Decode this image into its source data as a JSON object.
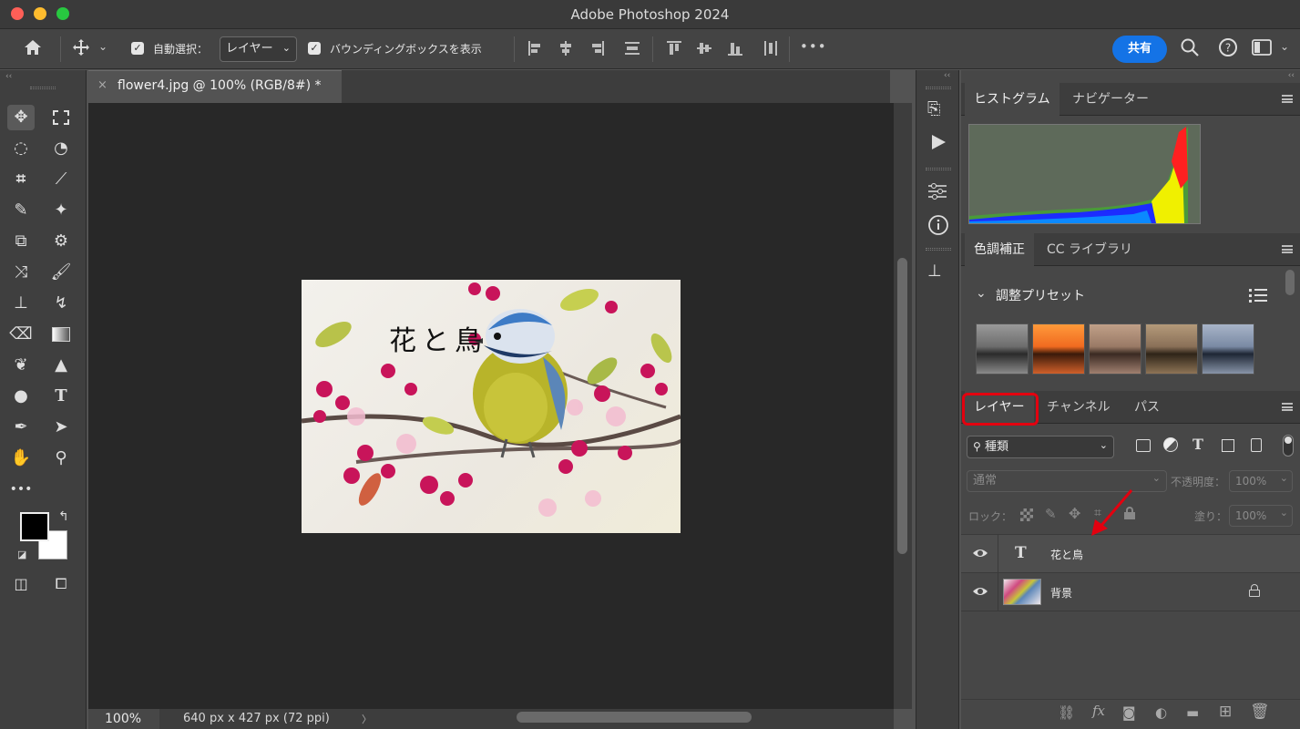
{
  "window": {
    "title": "Adobe Photoshop 2024"
  },
  "options_bar": {
    "auto_select_label": "自動選択：",
    "auto_select_value": "レイヤー",
    "bounding_box_label": "バウンディングボックスを表示",
    "share_label": "共有",
    "more_label": "•••"
  },
  "document": {
    "tab_label": "flower4.jpg @ 100% (RGB/8#) *",
    "close_glyph": "×",
    "canvas_text": "花と鳥",
    "zoom": "100%",
    "size_info": "640 px x 427 px (72 ppi)",
    "status_arrow": "〉"
  },
  "panels": {
    "histogram_tab": "ヒストグラム",
    "navigator_tab": "ナビゲーター",
    "adjust_tab": "色調補正",
    "cc_library_tab": "CC ライブラリ",
    "adjust_presets_title": "調整プリセット",
    "layers_tab": "レイヤー",
    "channels_tab": "チャンネル",
    "paths_tab": "パス",
    "filter_kind": "種類",
    "blend_mode": "通常",
    "opacity_label": "不透明度：",
    "opacity_value": "100%",
    "lock_label": "ロック：",
    "fill_label": "塗り：",
    "fill_value": "100%"
  },
  "layers": [
    {
      "name": "花と鳥",
      "type": "text"
    },
    {
      "name": "背景",
      "type": "image",
      "locked": true
    }
  ],
  "colors": {
    "accent": "#1473e6",
    "highlight": "#e3000f"
  }
}
